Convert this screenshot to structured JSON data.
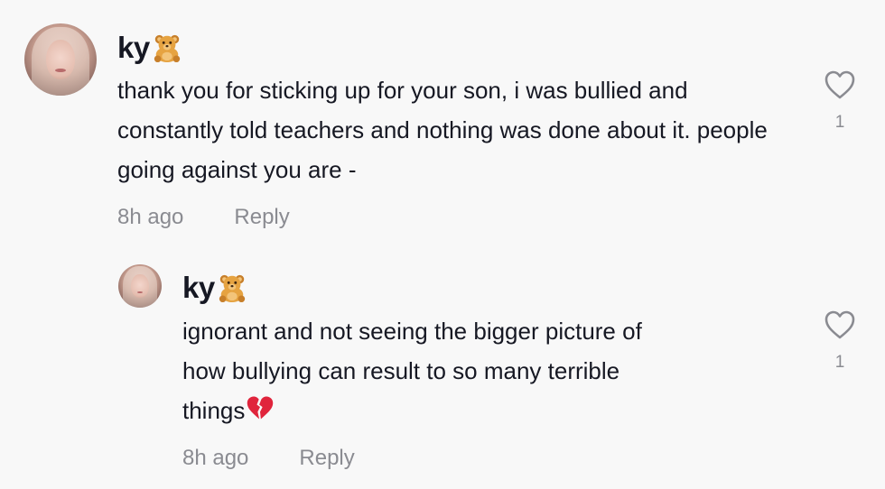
{
  "comments": [
    {
      "username": "ky",
      "emoji_icon": "teddy-bear-icon",
      "text": "thank you for sticking up for your son, i was bullied and constantly told teachers and nothing was done about it. people going against you are -",
      "time": "8h ago",
      "reply_label": "Reply",
      "likes": "1"
    },
    {
      "username": "ky",
      "emoji_icon": "teddy-bear-icon",
      "text_line1": "ignorant and not seeing the bigger picture of",
      "text_line2": "how bullying can result to so many terrible",
      "text_line3": "things",
      "trailing_icon": "broken-heart-icon",
      "time": "8h ago",
      "reply_label": "Reply",
      "likes": "1"
    }
  ],
  "colors": {
    "background": "#f8f8f8",
    "text": "#161823",
    "muted": "#8a8b91",
    "heart_outline": "#8a8b91",
    "broken_heart": "#e0243c",
    "bear": "#e6a341"
  }
}
